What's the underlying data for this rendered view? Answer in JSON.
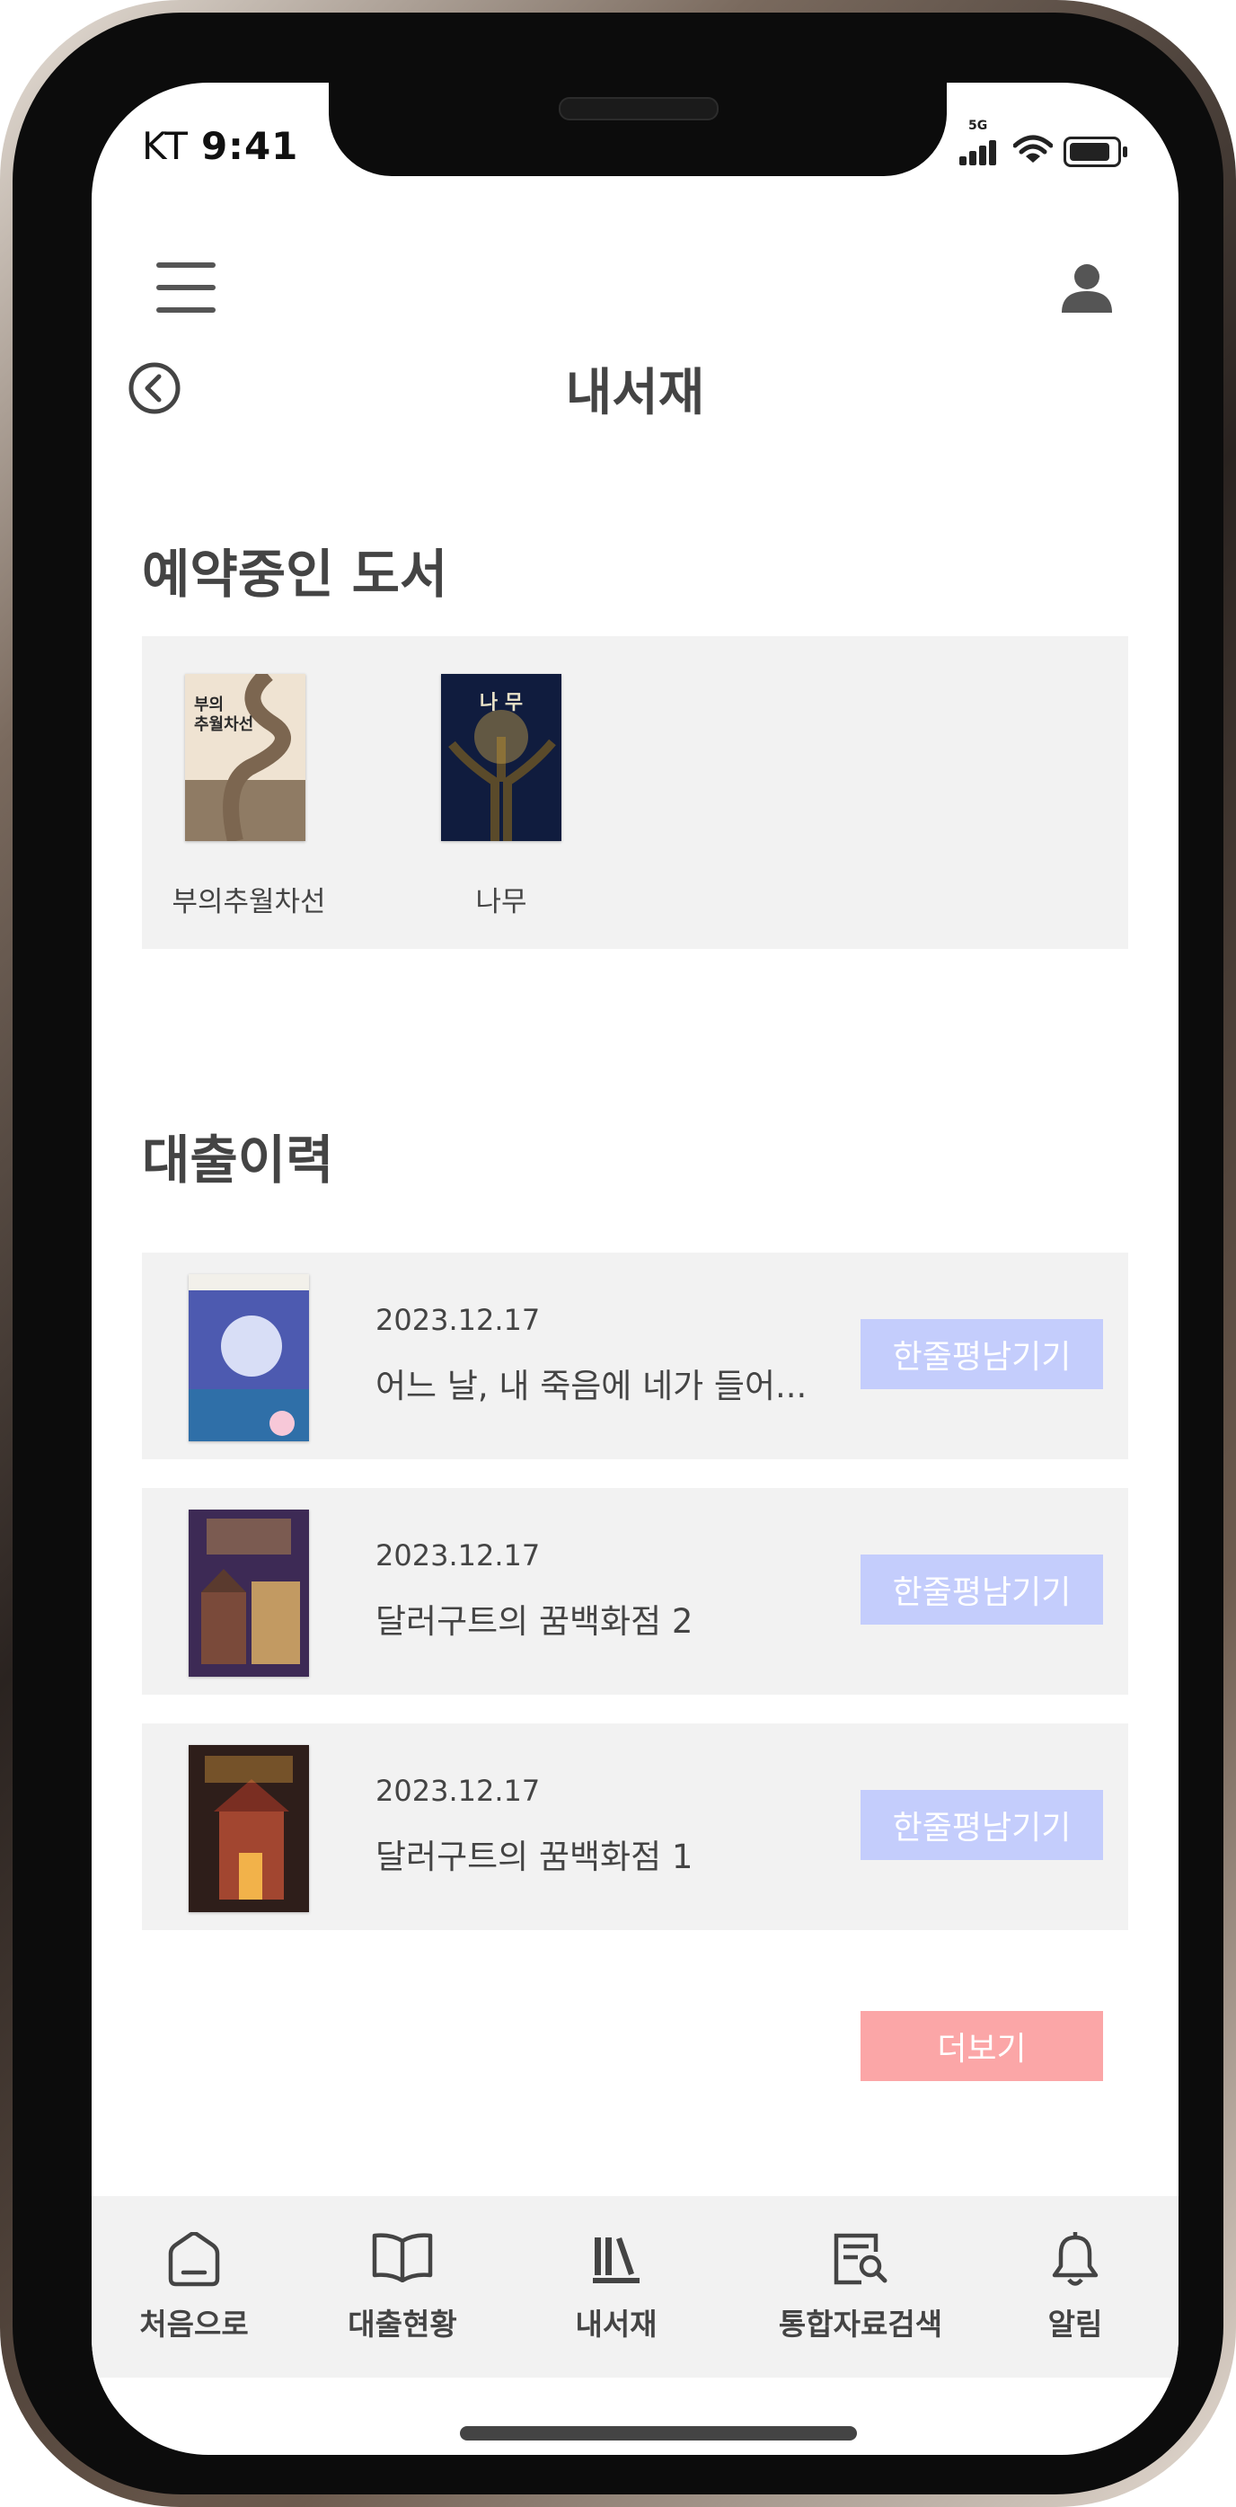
{
  "status_bar": {
    "carrier": "KT",
    "time": "9:41",
    "network": "5G"
  },
  "header": {
    "title": "내서재"
  },
  "reserved": {
    "section_title": "예약중인 도서",
    "books": [
      {
        "label": "부의추월차선",
        "cover_text": "부의\n추월차선"
      },
      {
        "label": "나무",
        "cover_text": "나 무"
      }
    ]
  },
  "history": {
    "section_title": "대출이력",
    "items": [
      {
        "date": "2023.12.17",
        "title": "어느 날, 내 죽음에 네가 들어...",
        "button": "한줄평남기기"
      },
      {
        "date": "2023.12.17",
        "title": "달러구트의 꿈백화점 2",
        "button": "한줄평남기기"
      },
      {
        "date": "2023.12.17",
        "title": "달러구트의 꿈백화점 1",
        "button": "한줄평남기기"
      }
    ],
    "more_button": "더보기"
  },
  "bottom_nav": {
    "items": [
      {
        "label": "처음으로",
        "icon": "home-icon"
      },
      {
        "label": "대출현황",
        "icon": "open-book-icon"
      },
      {
        "label": "내서재",
        "icon": "bookshelf-icon"
      },
      {
        "label": "통합자료검색",
        "icon": "search-catalog-icon"
      },
      {
        "label": "알림",
        "icon": "bell-icon"
      }
    ]
  },
  "colors": {
    "review_button": "#c4cdfc",
    "more_button": "#fba6a7",
    "panel_bg": "#f2f2f2",
    "text": "#444444"
  }
}
